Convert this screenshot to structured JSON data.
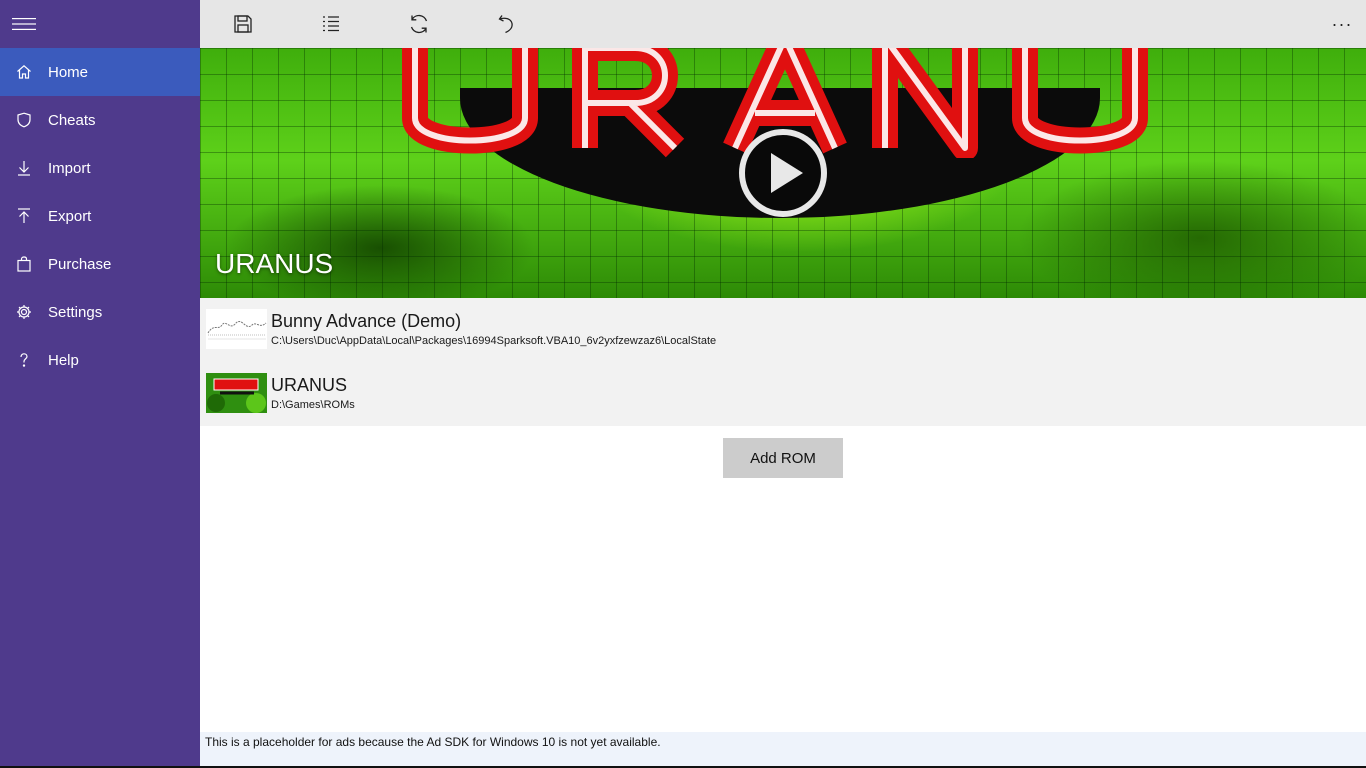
{
  "sidebar": {
    "menu_icon": "hamburger-icon",
    "items": [
      {
        "label": "Home",
        "icon": "home-icon",
        "selected": true
      },
      {
        "label": "Cheats",
        "icon": "shield-icon"
      },
      {
        "label": "Import",
        "icon": "download-icon"
      },
      {
        "label": "Export",
        "icon": "upload-icon"
      },
      {
        "label": "Purchase",
        "icon": "shopping-bag-icon"
      },
      {
        "label": "Settings",
        "icon": "gear-icon"
      },
      {
        "label": "Help",
        "icon": "help-icon"
      }
    ]
  },
  "toolbar": {
    "buttons": [
      "save-icon",
      "list-icon",
      "refresh-icon",
      "undo-icon"
    ],
    "more_label": "···"
  },
  "hero": {
    "title": "URANUS"
  },
  "roms": [
    {
      "name": "Bunny Advance (Demo)",
      "path": "C:\\Users\\Duc\\AppData\\Local\\Packages\\16994Sparksoft.VBA10_6v2yxfzewzaz6\\LocalState"
    },
    {
      "name": "URANUS",
      "path": "D:\\Games\\ROMs"
    }
  ],
  "add_rom_label": "Add ROM",
  "ad_text": "This is a placeholder for ads because the Ad SDK for Windows 10 is not yet available.",
  "colors": {
    "sidebar": "#4f3a8c",
    "selected": "#3b5bbd",
    "toolbar": "#e6e6e6"
  }
}
